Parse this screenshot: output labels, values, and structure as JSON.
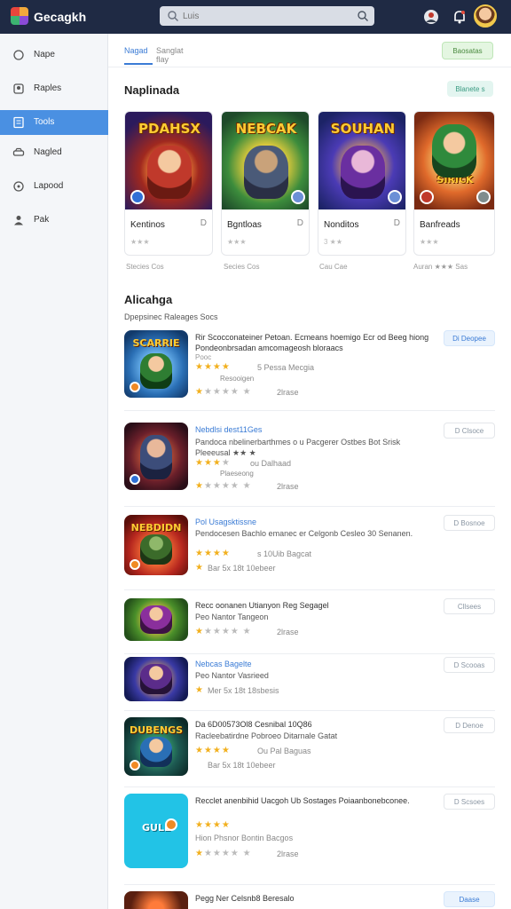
{
  "app": {
    "title": "Gecagkh"
  },
  "search": {
    "value": "Luis",
    "placeholder": "Luis"
  },
  "sidebar": {
    "items": [
      {
        "label": "Nape",
        "icon": "home-icon"
      },
      {
        "label": "Raples",
        "icon": "user-icon"
      },
      {
        "label": "Tools",
        "icon": "document-icon",
        "active": true
      },
      {
        "label": "Nagled",
        "icon": "car-icon"
      },
      {
        "label": "Lapood",
        "icon": "clock-icon"
      },
      {
        "label": "Pak",
        "icon": "person-icon"
      }
    ]
  },
  "tabs": [
    {
      "label": "Nagad",
      "active": true
    },
    {
      "label": "Sanglat flay",
      "active": false
    }
  ],
  "header_button": "Baosatas",
  "featured": {
    "title": "Naplinada",
    "button": "Blanete s",
    "cards": [
      {
        "art_title": "PDAHSX",
        "name": "Kentinos",
        "meta": "D",
        "stars": "★★★",
        "foot": "Stecies Cos"
      },
      {
        "art_title": "NEBCAK",
        "name": "Bgntloas",
        "meta": "D",
        "stars": "★★★",
        "foot": "Secies Cos"
      },
      {
        "art_title": "SOUHAN",
        "name": "Nonditos",
        "meta": "D",
        "stars": "3 ★★",
        "foot": "Cau Cae"
      },
      {
        "art_title": "SIRICK",
        "name": "Banfreads",
        "meta": "",
        "stars": "★★★",
        "foot": "Auran ★★★ Sas"
      }
    ]
  },
  "list": {
    "title": "Alicahga",
    "subtitle": "Dpepsinec Raleages Socs",
    "rows": [
      {
        "thumb_title": "SCARRIE",
        "line1": "Rir Scocconateiner Petoan. Ecmeans hoemigo Ecr od Beeg hiong Pondeonbrsadan amcomageosh bloraacs",
        "line2": "Pooc",
        "stars_on": "★★★★",
        "stars_off": "",
        "stars_extra": "5 Pessa Mecgia",
        "sub": "Resooigen",
        "stars2_on": "★",
        "stars2_off": "★★★★ ★",
        "meta": "2lrase",
        "button": "Di Deopee",
        "primary": true
      },
      {
        "thumb_title": "",
        "line1": "Nebdlsi dest11Ges",
        "line2": "Pandoca nbelinerbarthmes o u Pacgerer Ostbes Bot Srisk Pleeeusal ★★ ★",
        "line2b": "",
        "stars_on": "★★★",
        "stars_off": "★",
        "stars_extra": "ou Dalhaad",
        "sub": "Plaeseong",
        "stars2_on": "★",
        "stars2_off": "★★★★ ★",
        "meta": "2lrase",
        "button": "D Clsoce",
        "primary": false
      },
      {
        "thumb_title": "NEBDIDN",
        "line1": "Pol Usagsktissne",
        "line2": "Pendocesen Bachlo emanec er Celgonb Cesleo 30 Senanen.",
        "stars_on": "★★★★",
        "stars_off": "",
        "stars_extra": "s 10Uib Bagcat",
        "sub": "",
        "stars2_on": "★",
        "stars2_off": "",
        "meta": "Bar 5x  18t  10ebeer",
        "button": "D Bosnoe",
        "primary": false
      },
      {
        "thumb_title": "",
        "line1": "Recc oonanen Utianyon Reg Segagel",
        "line2": "Peo Nantor Tangeon",
        "stars_on": "★",
        "stars_off": "★★★★ ★",
        "stars_extra": "",
        "sub": "",
        "meta": "2lrase",
        "button": "Cllsees",
        "primary": false
      },
      {
        "thumb_title": "",
        "line1": "Nebcas Bagelte",
        "line2": "Peo Nantor Vasrieed",
        "stars_on": "★",
        "stars_off": "",
        "stars_extra": "",
        "sub": "",
        "meta": "Mer 5x  18t  18sbesis",
        "button": "D Scooas",
        "primary": false
      },
      {
        "thumb_title": "DUBENGS",
        "line1": "Da 6D00573Ol8 Cesnibal 10Q86",
        "line2": "Racleebatirdne Pobroeo Ditarnale Gatat",
        "stars_on": "★★★★",
        "stars_off": "",
        "stars_extra": "Ou Pal Baguas",
        "sub": "",
        "meta": "Bar 5x  18t  10ebeer",
        "button": "D Denoe",
        "primary": false
      },
      {
        "thumb_title": "GULL",
        "line1": "Recclet anenbihid Uacgoh Ub Sostages Poiaanbonebconee.",
        "line2": "",
        "stars_on": "★★★★",
        "stars_off": "",
        "stars_extra": "",
        "sub": "Hion Phsnor Bontin Bacgos",
        "stars2_on": "★",
        "stars2_off": "★★★★ ★",
        "meta": "2lrase",
        "button": "D Scsoes",
        "primary": false
      },
      {
        "thumb_title": "",
        "line1": "Pegg Ner Celsnb8 Beresalo",
        "line2": "",
        "stars_on": "",
        "stars_off": "",
        "stars_extra": "",
        "sub": "",
        "meta": "",
        "button": "Daase",
        "primary": true
      }
    ]
  },
  "colors": {
    "topbar": "#1f2a44",
    "accent": "#4a90e2",
    "star": "#f2b01e"
  }
}
